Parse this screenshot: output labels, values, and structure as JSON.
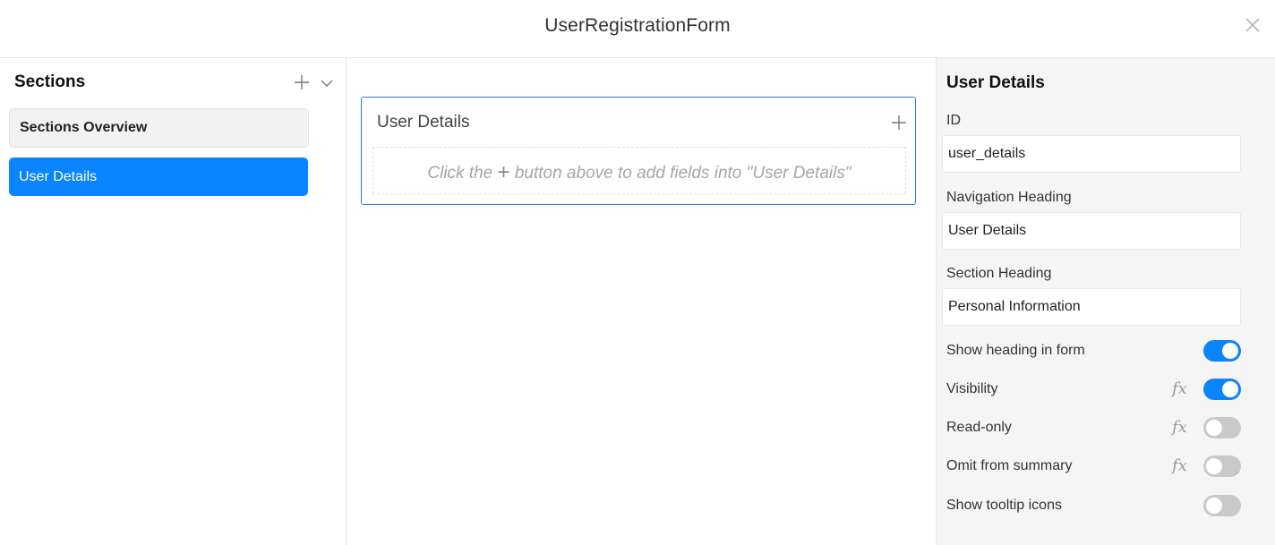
{
  "window": {
    "title": "UserRegistrationForm",
    "close_icon": "close-icon"
  },
  "sections_panel": {
    "title": "Sections",
    "items": [
      {
        "label": "Sections Overview",
        "selected": false
      },
      {
        "label": "User Details",
        "selected": true
      }
    ]
  },
  "canvas": {
    "section_title": "User Details",
    "hint_prefix": "Click the",
    "hint_plus": "+",
    "hint_suffix": "button above to add fields into \"User Details\""
  },
  "properties": {
    "title": "User Details",
    "id_label": "ID",
    "id_value": "user_details",
    "nav_heading_label": "Navigation Heading",
    "nav_heading_value": "User Details",
    "section_heading_label": "Section Heading",
    "section_heading_value": "Personal Information",
    "toggles": [
      {
        "label": "Show heading in form",
        "on": true,
        "fx": false
      },
      {
        "label": "Visibility",
        "on": true,
        "fx": true
      },
      {
        "label": "Read-only",
        "on": false,
        "fx": true
      },
      {
        "label": "Omit from summary",
        "on": false,
        "fx": true
      },
      {
        "label": "Show tooltip icons",
        "on": false,
        "fx": false
      }
    ],
    "fx_label": "fx"
  },
  "colors": {
    "accent": "#0a84ff",
    "card_border": "#2b7bd6",
    "toggle_off": "#c9c9c9"
  }
}
